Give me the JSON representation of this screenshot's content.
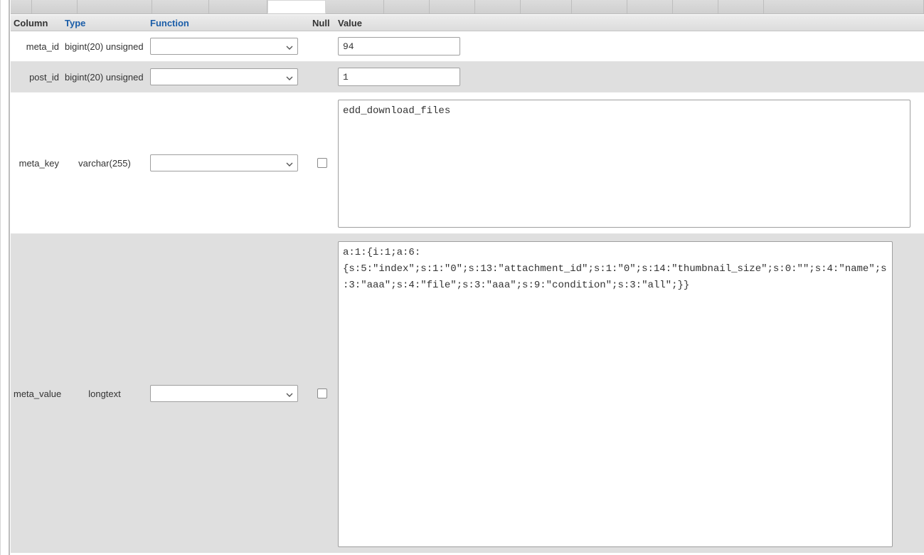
{
  "toolbar": {
    "tab_widths": [
      30,
      64,
      105,
      80,
      82,
      20,
      82,
      82,
      64,
      64,
      64,
      72,
      78,
      64,
      64,
      64,
      64,
      72,
      64
    ]
  },
  "headers": {
    "column": "Column",
    "type": "Type",
    "function": "Function",
    "null": "Null",
    "value": "Value"
  },
  "rows": [
    {
      "column": "meta_id",
      "type": "bigint(20) unsigned",
      "function_selected": "",
      "nullable": false,
      "value": "94",
      "control": "input"
    },
    {
      "column": "post_id",
      "type": "bigint(20) unsigned",
      "function_selected": "",
      "nullable": false,
      "value": "1",
      "control": "input"
    },
    {
      "column": "meta_key",
      "type": "varchar(255)",
      "function_selected": "",
      "nullable": true,
      "null_checked": false,
      "value": "edd_download_files",
      "control": "textarea_small"
    },
    {
      "column": "meta_value",
      "type": "longtext",
      "function_selected": "",
      "nullable": true,
      "null_checked": false,
      "value": "a:1:{i:1;a:6:{s:5:\"index\";s:1:\"0\";s:13:\"attachment_id\";s:1:\"0\";s:14:\"thumbnail_size\";s:0:\"\";s:4:\"name\";s:3:\"aaa\";s:4:\"file\";s:3:\"aaa\";s:9:\"condition\";s:3:\"all\";}}",
      "control": "textarea_large"
    }
  ]
}
